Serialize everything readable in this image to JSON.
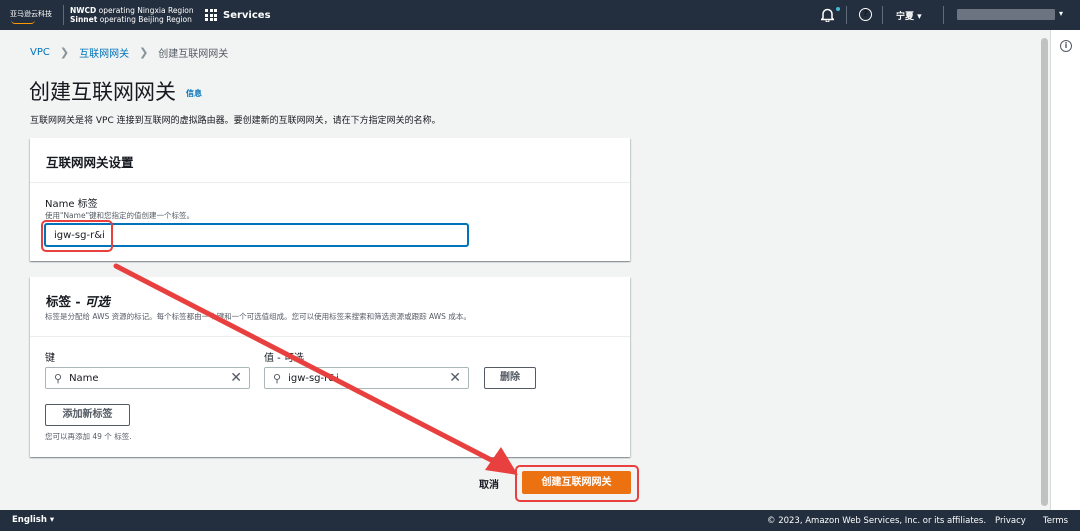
{
  "topbar": {
    "logo_text": "亚马逊云科技",
    "region_line1_bold": "NWCD",
    "region_line1": "operating Ningxia Region",
    "region_line2_bold": "Sinnet",
    "region_line2": "operating Beijing Region",
    "services_label": "Services",
    "region_select": "宁夏 ▾",
    "help_icon": "?",
    "acct_caret": "▾"
  },
  "breadcrumb": {
    "items": [
      "VPC",
      "互联网网关",
      "创建互联网网关"
    ]
  },
  "page": {
    "title": "创建互联网网关",
    "info_link": "信息",
    "description": "互联网网关是将 VPC 连接到互联网的虚拟路由器。要创建新的互联网网关，请在下方指定网关的名称。"
  },
  "settings_panel": {
    "header": "互联网网关设置",
    "name_label": "Name 标签",
    "name_desc": "使用\"Name\"键和您指定的值创建一个标签。",
    "name_value": "igw-sg-r&i"
  },
  "tags_panel": {
    "header": "标签 - ",
    "header_optional": "可选",
    "description": "标签是分配给 AWS 资源的标记。每个标签都由一个键和一个可选值组成。您可以使用标签来搜索和筛选资源或跟踪 AWS 成本。",
    "key_col": "键",
    "value_col": "值 - 可选",
    "key_value": "Name",
    "value_value": "igw-sg-r&i",
    "delete_button": "删除",
    "add_button": "添加新标签",
    "footer_note": "您可以再添加 49 个 标签."
  },
  "actions": {
    "cancel": "取消",
    "create": "创建互联网网关"
  },
  "footer": {
    "language": "English ▾",
    "copyright": "© 2023, Amazon Web Services, Inc. or its affiliates.",
    "privacy": "Privacy",
    "terms": "Terms"
  },
  "rail": {
    "info_icon": "i"
  },
  "icons": {
    "search": "magnifier-icon",
    "clear": "x-icon"
  },
  "colors": {
    "topbar_bg": "#232f3e",
    "link": "#0073bb",
    "primary_button": "#ec7211",
    "annotation_red": "#e8403e"
  }
}
